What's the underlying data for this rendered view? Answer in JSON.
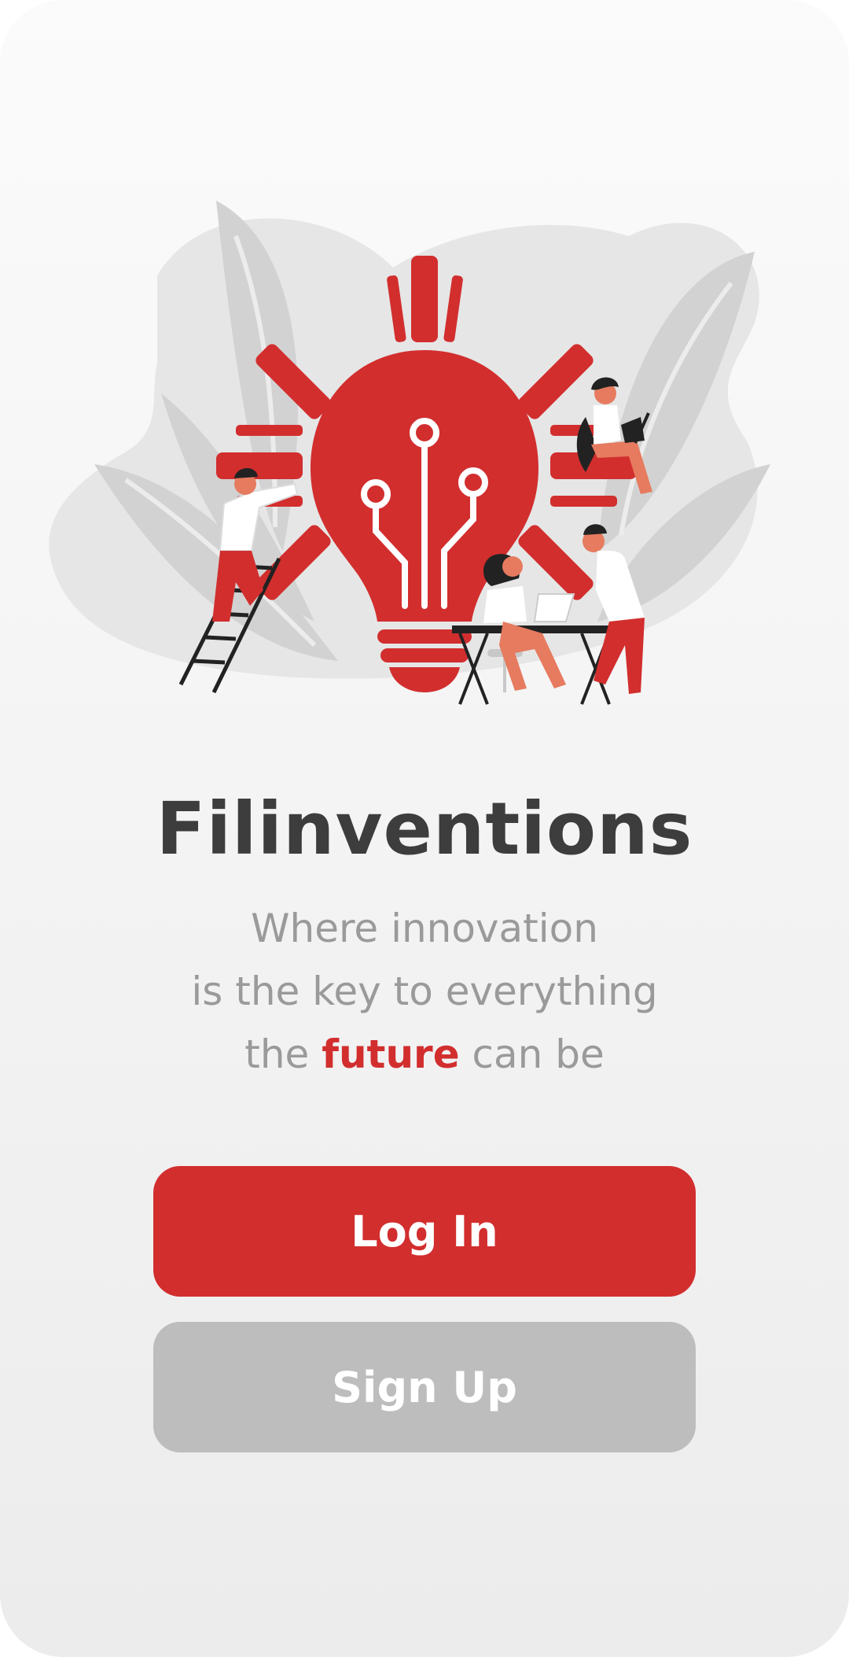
{
  "app": {
    "title": "Filinventions",
    "tagline": {
      "line1": "Where innovation",
      "line2": "is the key to everything",
      "line3_prefix": "the",
      "line3_accent": "future",
      "line3_suffix": "can be"
    }
  },
  "actions": {
    "login_label": "Log In",
    "signup_label": "Sign Up"
  },
  "colors": {
    "brand_red": "#d22e2e",
    "title_text": "#3d3d3d",
    "muted_text": "#9a9a9a",
    "secondary_button": "#bdbdbd",
    "leaf_gray": "#d2d2d2"
  },
  "illustration": {
    "icon": "lightbulb-sun-team-illustration"
  }
}
